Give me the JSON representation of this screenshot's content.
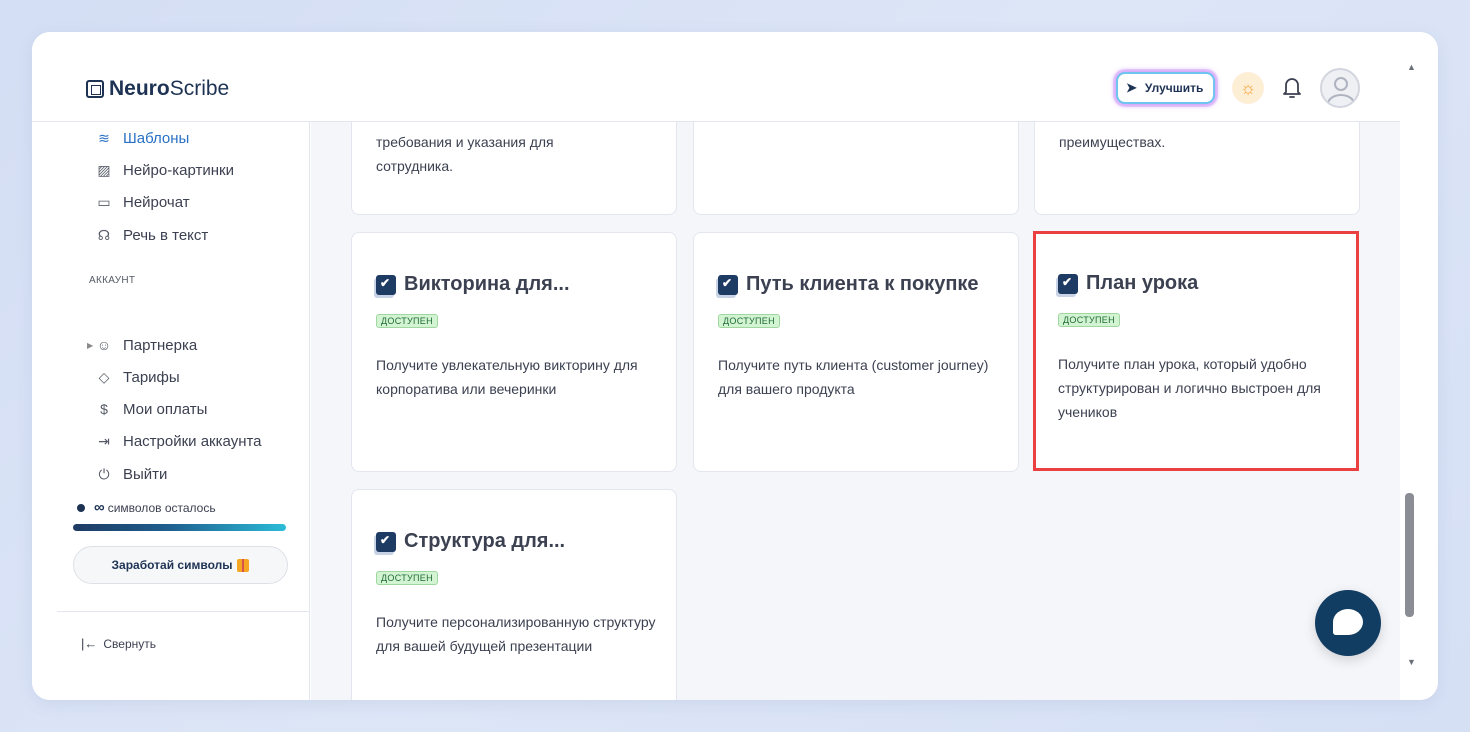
{
  "header": {
    "logo_bold": "Neuro",
    "logo_rest": "Scribe",
    "upgrade_label": "Улучшить"
  },
  "sidebar": {
    "items": [
      {
        "label": "Шаблоны",
        "icon": "layers-icon",
        "active": true
      },
      {
        "label": "Нейро-картинки",
        "icon": "image-icon"
      },
      {
        "label": "Нейрочат",
        "icon": "chat-icon"
      },
      {
        "label": "Речь в текст",
        "icon": "headphones-icon"
      }
    ],
    "section_label": "АККАУНТ",
    "account_items": [
      {
        "label": "Партнерка",
        "icon": "users-icon"
      },
      {
        "label": "Тарифы",
        "icon": "tag-icon"
      },
      {
        "label": "Мои оплаты",
        "icon": "dollar-icon"
      },
      {
        "label": "Настройки аккаунта",
        "icon": "login-icon"
      },
      {
        "label": "Выйти",
        "icon": "power-icon"
      }
    ],
    "symbols_value": "∞",
    "symbols_label": "символов осталось",
    "earn_label": "Заработай символы",
    "collapse_label": "Свернуть"
  },
  "top_cards": [
    {
      "desc_lines": [
        "требования и указания для",
        "сотрудника."
      ]
    },
    {
      "desc_lines": []
    },
    {
      "desc_lines": [
        "преимуществах."
      ]
    }
  ],
  "cards": [
    {
      "title": "Викторина для...",
      "badge": "ДОСТУПЕН",
      "desc": "Получите увлекательную викторину для корпоратива или вечеринки"
    },
    {
      "title": "Путь клиента к покупке",
      "badge": "ДОСТУПЕН",
      "desc": "Получите путь клиента (customer journey) для вашего продукта"
    },
    {
      "title": "План урока",
      "badge": "ДОСТУПЕН",
      "desc": "Получите план урока, который удобно структурирован и логично выстроен для учеников",
      "highlighted": true
    },
    {
      "title": "Структура для...",
      "badge": "ДОСТУПЕН",
      "desc": "Получите персонализированную структуру для вашей будущей презентации"
    }
  ],
  "colors": {
    "accent": "#2870c4",
    "brand": "#1e3354",
    "highlight": "#ea4040",
    "badge_bg": "#d3f4d3"
  }
}
